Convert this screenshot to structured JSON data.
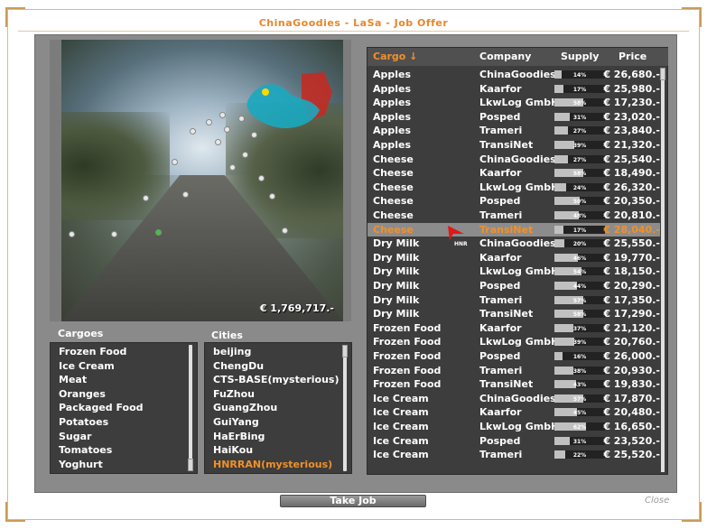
{
  "window": {
    "title": "ChinaGoodies - LaSa - Job Offer"
  },
  "scene": {
    "balance": "€ 1,769,717.-"
  },
  "cargoes": {
    "label": "Cargoes",
    "items": [
      "Frozen Food",
      "Ice Cream",
      "Meat",
      "Oranges",
      "Packaged Food",
      "Potatoes",
      "Sugar",
      "Tomatoes",
      "Yoghurt"
    ]
  },
  "cities": {
    "label": "Cities",
    "items": [
      {
        "name": "beijing",
        "mysterious": false
      },
      {
        "name": "ChengDu",
        "mysterious": false
      },
      {
        "name": "CTS-BASE(mysterious)",
        "mysterious": false
      },
      {
        "name": "FuZhou",
        "mysterious": false
      },
      {
        "name": "GuangZhou",
        "mysterious": false
      },
      {
        "name": "GuiYang",
        "mysterious": false
      },
      {
        "name": "HaErBing",
        "mysterious": false
      },
      {
        "name": "HaiKou",
        "mysterious": false
      },
      {
        "name": "HNRRAN(mysterious)",
        "mysterious": true
      }
    ]
  },
  "offers": {
    "headers": {
      "cargo": "Cargo ↓",
      "company": "Company",
      "supply": "Supply",
      "price": "Price"
    },
    "rows": [
      {
        "cargo": "Apples",
        "company": "ChinaGoodies",
        "supply": 14,
        "price": "€ 26,680.-",
        "selected": false
      },
      {
        "cargo": "Apples",
        "company": "Kaarfor",
        "supply": 17,
        "price": "€ 25,980.-",
        "selected": false
      },
      {
        "cargo": "Apples",
        "company": "LkwLog GmbH",
        "supply": 58,
        "price": "€ 17,230.-",
        "selected": false
      },
      {
        "cargo": "Apples",
        "company": "Posped",
        "supply": 31,
        "price": "€ 23,020.-",
        "selected": false
      },
      {
        "cargo": "Apples",
        "company": "Trameri",
        "supply": 27,
        "price": "€ 23,840.-",
        "selected": false
      },
      {
        "cargo": "Apples",
        "company": "TransiNet",
        "supply": 39,
        "price": "€ 21,320.-",
        "selected": false
      },
      {
        "cargo": "Cheese",
        "company": "ChinaGoodies",
        "supply": 27,
        "price": "€ 25,540.-",
        "selected": false
      },
      {
        "cargo": "Cheese",
        "company": "Kaarfor",
        "supply": 58,
        "price": "€ 18,490.-",
        "selected": false
      },
      {
        "cargo": "Cheese",
        "company": "LkwLog GmbH",
        "supply": 24,
        "price": "€ 26,320.-",
        "selected": false
      },
      {
        "cargo": "Cheese",
        "company": "Posped",
        "supply": 50,
        "price": "€ 20,350.-",
        "selected": false
      },
      {
        "cargo": "Cheese",
        "company": "Trameri",
        "supply": 48,
        "price": "€ 20,810.-",
        "selected": false
      },
      {
        "cargo": "Cheese",
        "company": "TransiNet",
        "supply": 17,
        "price": "€ 28,040.-",
        "selected": true
      },
      {
        "cargo": "Dry Milk",
        "company": "ChinaGoodies",
        "supply": 20,
        "price": "€ 25,550.-",
        "selected": false
      },
      {
        "cargo": "Dry Milk",
        "company": "Kaarfor",
        "supply": 46,
        "price": "€ 19,770.-",
        "selected": false
      },
      {
        "cargo": "Dry Milk",
        "company": "LkwLog GmbH",
        "supply": 54,
        "price": "€ 18,150.-",
        "selected": false
      },
      {
        "cargo": "Dry Milk",
        "company": "Posped",
        "supply": 44,
        "price": "€ 20,290.-",
        "selected": false
      },
      {
        "cargo": "Dry Milk",
        "company": "Trameri",
        "supply": 57,
        "price": "€ 17,350.-",
        "selected": false
      },
      {
        "cargo": "Dry Milk",
        "company": "TransiNet",
        "supply": 58,
        "price": "€ 17,290.-",
        "selected": false
      },
      {
        "cargo": "Frozen Food",
        "company": "Kaarfor",
        "supply": 37,
        "price": "€ 21,120.-",
        "selected": false
      },
      {
        "cargo": "Frozen Food",
        "company": "LkwLog GmbH",
        "supply": 39,
        "price": "€ 20,760.-",
        "selected": false
      },
      {
        "cargo": "Frozen Food",
        "company": "Posped",
        "supply": 16,
        "price": "€ 26,000.-",
        "selected": false
      },
      {
        "cargo": "Frozen Food",
        "company": "Trameri",
        "supply": 38,
        "price": "€ 20,930.-",
        "selected": false
      },
      {
        "cargo": "Frozen Food",
        "company": "TransiNet",
        "supply": 43,
        "price": "€ 19,830.-",
        "selected": false
      },
      {
        "cargo": "Ice Cream",
        "company": "ChinaGoodies",
        "supply": 57,
        "price": "€ 17,870.-",
        "selected": false
      },
      {
        "cargo": "Ice Cream",
        "company": "Kaarfor",
        "supply": 45,
        "price": "€ 20,480.-",
        "selected": false
      },
      {
        "cargo": "Ice Cream",
        "company": "LkwLog GmbH",
        "supply": 62,
        "price": "€ 16,650.-",
        "selected": false
      },
      {
        "cargo": "Ice Cream",
        "company": "Posped",
        "supply": 31,
        "price": "€ 23,520.-",
        "selected": false
      },
      {
        "cargo": "Ice Cream",
        "company": "Trameri",
        "supply": 22,
        "price": "€ 25,520.-",
        "selected": false
      }
    ]
  },
  "cursor": {
    "label": "HNR"
  },
  "buttons": {
    "take_job": "Take Job",
    "close": "Close"
  },
  "colors": {
    "accent": "#f0902a",
    "panel": "#3d3d3d",
    "frame": "#8a8a8a"
  }
}
